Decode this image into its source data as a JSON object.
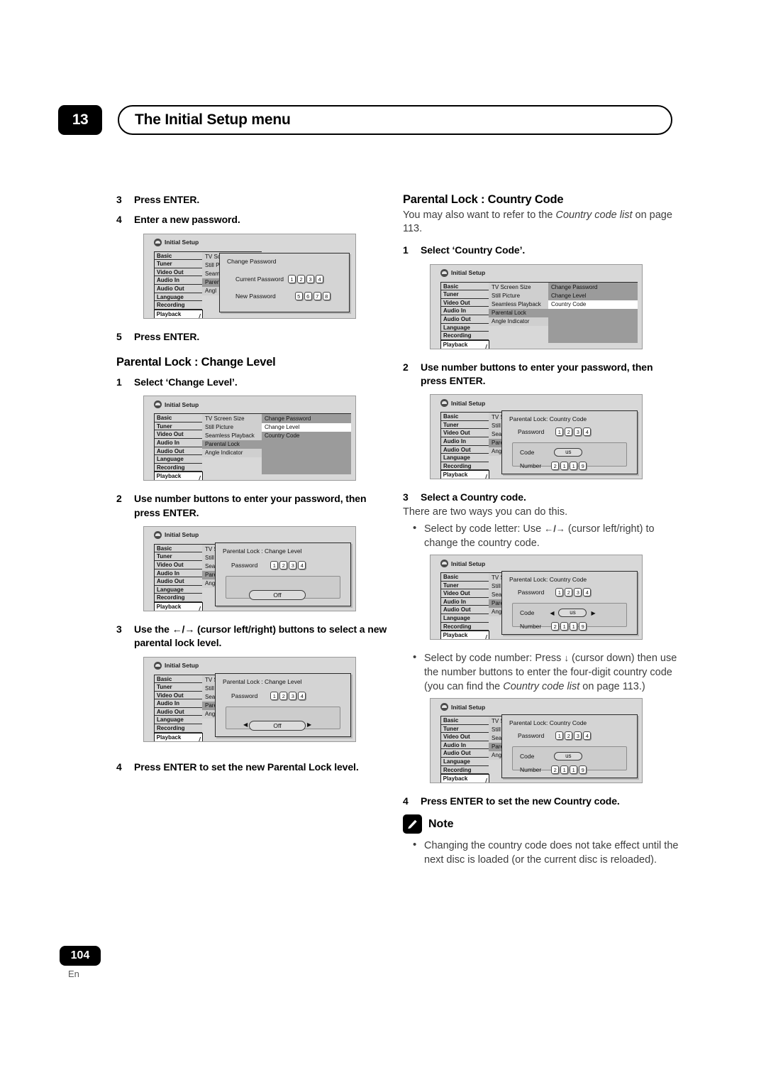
{
  "header": {
    "chapter": "13",
    "title": "The Initial Setup menu"
  },
  "footer": {
    "page_number": "104",
    "language": "En"
  },
  "osd_common": {
    "app_title": "Initial Setup",
    "menu1": [
      "Basic",
      "Tuner",
      "Video Out",
      "Audio In",
      "Audio Out",
      "Language",
      "Recording",
      "Playback"
    ],
    "menu1_selected": "Playback",
    "menu2_full": [
      "TV Screen Size",
      "Still Picture",
      "Seamless Playback",
      "Parental Lock",
      "Angle Indicator"
    ],
    "menu2_clipped": [
      "TV Sc",
      "Still P",
      "Seam",
      "Paren",
      "Angl"
    ],
    "menu2_selected": "Parental Lock",
    "menu3": [
      "Change Password",
      "Change Level",
      "Country Code"
    ]
  },
  "left_column": {
    "step3": {
      "num": "3",
      "text": "Press ENTER."
    },
    "step4": {
      "num": "4",
      "text": "Enter a new password."
    },
    "fig_change_password": {
      "dialog_title": "Change Password",
      "row1_label": "Current Password",
      "row1_keys": [
        "1",
        "2",
        "3",
        "4"
      ],
      "row2_label": "New Password",
      "row2_keys": [
        "5",
        "6",
        "7",
        "8"
      ]
    },
    "step5": {
      "num": "5",
      "text": "Press ENTER."
    },
    "section_title": "Parental Lock : Change Level",
    "cl_step1": {
      "num": "1",
      "text": "Select ‘Change Level’."
    },
    "fig_menu_change_level": {
      "highlighted": "Change Level"
    },
    "cl_step2": {
      "num": "2",
      "text": "Use number buttons to enter your password, then press ENTER."
    },
    "fig_password_off": {
      "dialog_title": "Parental Lock : Change Level",
      "password_label": "Password",
      "password_keys": [
        "1",
        "2",
        "3",
        "4"
      ],
      "option_value": "Off"
    },
    "cl_step3": {
      "num": "3",
      "text": "Use the ←/→ (cursor left/right) buttons to select a new parental lock level."
    },
    "fig_password_off_arrows": {
      "dialog_title": "Parental Lock : Change Level",
      "password_label": "Password",
      "password_keys": [
        "1",
        "2",
        "3",
        "4"
      ],
      "option_value": "Off",
      "left_arrow": "◀",
      "right_arrow": "▶"
    },
    "cl_step4": {
      "num": "4",
      "text": "Press ENTER to set the new Parental Lock level."
    }
  },
  "right_column": {
    "section_title": "Parental Lock : Country Code",
    "intro_pre": "You may also want to refer to the ",
    "intro_ital": "Country code list",
    "intro_post": " on page 113.",
    "cc_step1": {
      "num": "1",
      "text": "Select ‘Country Code’."
    },
    "fig_menu_country_code": {
      "highlighted": "Country Code"
    },
    "cc_step2": {
      "num": "2",
      "text": "Use number buttons to enter your password, then press ENTER."
    },
    "fig_country_code_1": {
      "dialog_title": "Parental Lock: Country Code",
      "password_label": "Password",
      "password_keys": [
        "1",
        "2",
        "3",
        "4"
      ],
      "code_label": "Code",
      "code_value": "us",
      "number_label": "Number",
      "number_keys": [
        "2",
        "1",
        "1",
        "9"
      ]
    },
    "cc_step3": {
      "num": "3",
      "text": "Select a Country code."
    },
    "cc_step3_plain": "There are two ways you can do this.",
    "bullet1_pre": "Select by code letter: Use ",
    "bullet1_arrows": "←/→",
    "bullet1_post": " (cursor left/right) to change the country code.",
    "fig_country_code_2": {
      "dialog_title": "Parental Lock: Country Code",
      "password_label": "Password",
      "password_keys": [
        "1",
        "2",
        "3",
        "4"
      ],
      "code_label": "Code",
      "code_value": "us",
      "number_label": "Number",
      "number_keys": [
        "2",
        "1",
        "1",
        "9"
      ],
      "left_arrow": "◀",
      "right_arrow": "▶"
    },
    "bullet2_pre": "Select by code number: Press ",
    "bullet2_arrow": "↓",
    "bullet2_mid": " (cursor down) then use the number buttons to enter the four-digit country code (you can find the ",
    "bullet2_ital": "Country code list",
    "bullet2_post": " on page 113.)",
    "fig_country_code_3": {
      "dialog_title": "Parental Lock: Country Code",
      "password_label": "Password",
      "password_keys": [
        "1",
        "2",
        "3",
        "4"
      ],
      "code_label": "Code",
      "code_value": "us",
      "number_label": "Number",
      "number_keys": [
        "2",
        "1",
        "1",
        "9"
      ]
    },
    "cc_step4": {
      "num": "4",
      "text": "Press ENTER to set the new Country code."
    },
    "note": {
      "label": "Note",
      "icon": "pencil-icon",
      "text": "Changing the country code does not take effect until the next disc is loaded (or the current disc is reloaded)."
    }
  }
}
